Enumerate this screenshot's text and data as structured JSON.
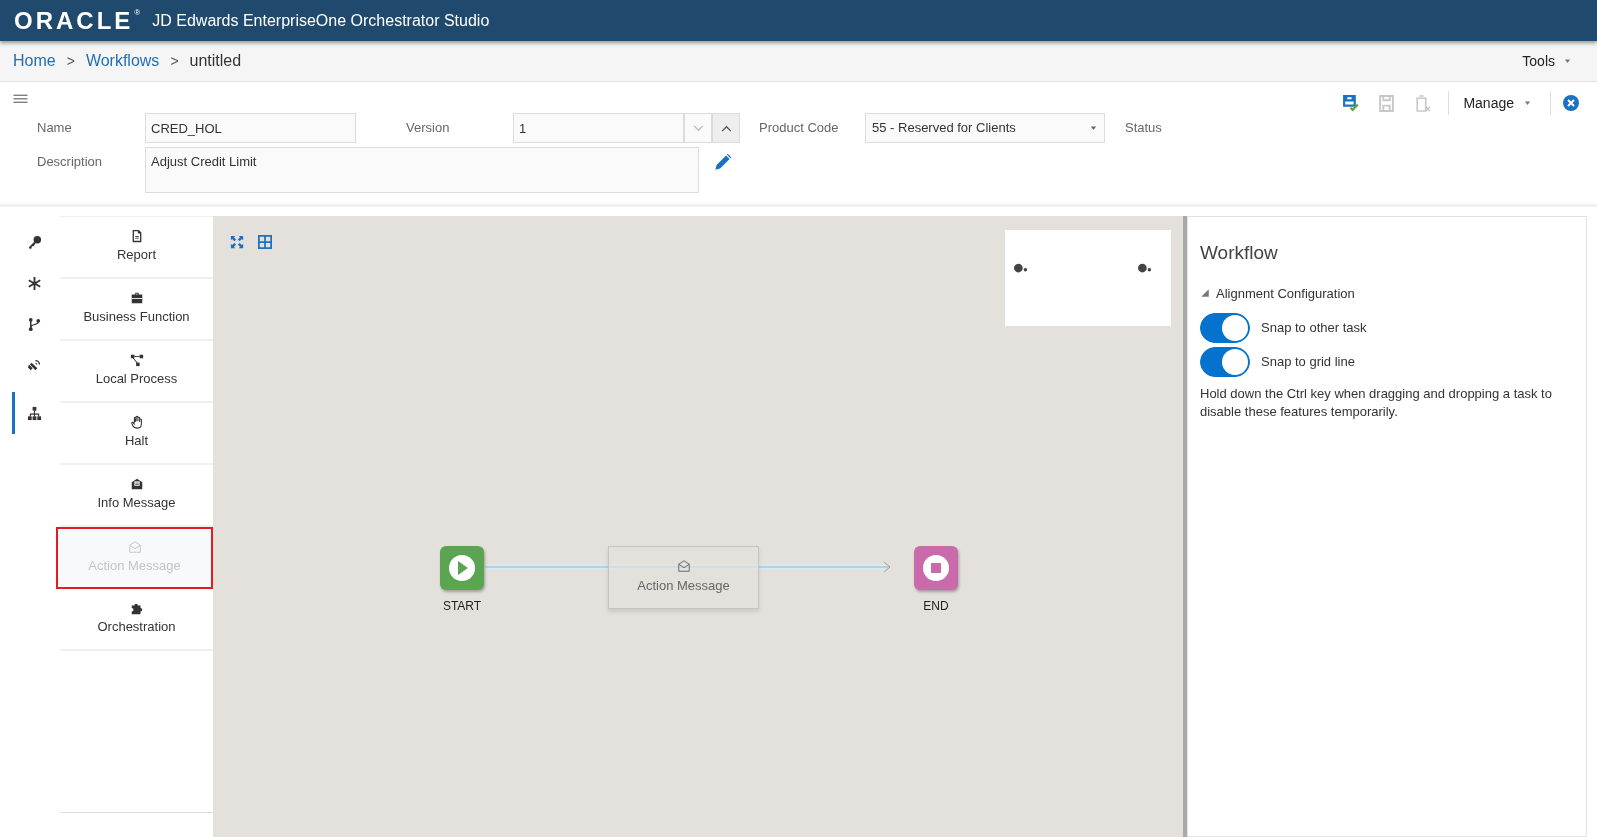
{
  "header": {
    "logo": "ORACLE",
    "logo_mark": "®",
    "title": "JD Edwards EnterpriseOne Orchestrator Studio"
  },
  "breadcrumb": [
    {
      "label": "Home",
      "kind": "link"
    },
    {
      "label": ">",
      "kind": "separator"
    },
    {
      "label": "Workflows",
      "kind": "link"
    },
    {
      "label": ">",
      "kind": "separator"
    },
    {
      "label": "untitled",
      "kind": "current"
    }
  ],
  "tools_menu": "Tools",
  "toolbar": {
    "actions": [
      {
        "kind": "save-check",
        "disabled": false
      },
      {
        "kind": "save",
        "disabled": true
      },
      {
        "kind": "delete",
        "disabled": true
      }
    ],
    "manage_menu": "Manage"
  },
  "form": {
    "name": {
      "label": "Name",
      "value": "CRED_HOL"
    },
    "version": {
      "label": "Version",
      "value": "1"
    },
    "product_code": {
      "label": "Product Code",
      "value": "55 - Reserved for Clients"
    },
    "status": {
      "label": "Status"
    },
    "description": {
      "label": "Description",
      "value": "Adjust Credit Limit"
    }
  },
  "rail": [
    {
      "kind": "key",
      "selected": false
    },
    {
      "kind": "asterisk",
      "selected": false
    },
    {
      "kind": "branch",
      "selected": false
    },
    {
      "kind": "satellite",
      "selected": false
    },
    {
      "kind": "hierarchy",
      "selected": true
    }
  ],
  "palette": [
    {
      "label": "Report",
      "kind": "report",
      "disabled": false,
      "highlighted": false
    },
    {
      "label": "Business Function",
      "kind": "briefcase",
      "disabled": false,
      "highlighted": false
    },
    {
      "label": "Local Process",
      "kind": "process",
      "disabled": false,
      "highlighted": false
    },
    {
      "label": "Halt",
      "kind": "hand",
      "disabled": false,
      "highlighted": false
    },
    {
      "label": "Info Message",
      "kind": "info",
      "disabled": false,
      "highlighted": false
    },
    {
      "label": "Action Message",
      "kind": "envelope",
      "disabled": true,
      "highlighted": true
    },
    {
      "label": "Orchestration",
      "kind": "puzzle",
      "disabled": false,
      "highlighted": false
    }
  ],
  "canvas": {
    "start": {
      "label": "START"
    },
    "task": {
      "label": "Action Message"
    },
    "end": {
      "label": "END"
    }
  },
  "panel": {
    "title": "Workflow",
    "section": {
      "label": "Alignment Configuration",
      "expanded": true
    },
    "toggles": [
      {
        "label": "Snap to other task",
        "on": true
      },
      {
        "label": "Snap to grid line",
        "on": true
      }
    ],
    "note": "Hold down the Ctrl key when dragging and dropping a task to disable these features temporarily."
  }
}
